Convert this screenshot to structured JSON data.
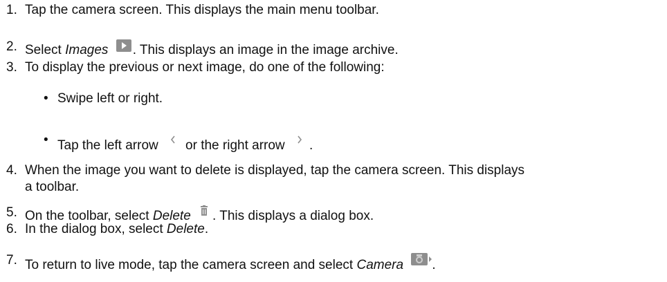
{
  "steps": [
    {
      "num": "1.",
      "text": "Tap the camera screen. This displays the main menu toolbar."
    },
    {
      "num": "2.",
      "pre": "Select ",
      "italic": "Images",
      "post": ". This displays an image in the image archive.",
      "icon": "play-image-icon"
    },
    {
      "num": "3.",
      "text": "To display the previous or next image, do one of the following:"
    },
    {
      "num": "4.",
      "line1": "When the image you want to delete is displayed, tap the camera screen. This displays",
      "line2": "a toolbar."
    },
    {
      "num": "5.",
      "pre": "On the toolbar, select ",
      "italic": "Delete",
      "post": ". This displays a dialog box.",
      "icon": "trash-icon"
    },
    {
      "num": "6.",
      "pre": "In the dialog box, select ",
      "italic": "Delete",
      "post": "."
    },
    {
      "num": "7.",
      "pre": "To return to live mode, tap the camera screen and select ",
      "italic": "Camera",
      "post": ".",
      "icon": "camera-icon"
    }
  ],
  "bullets": [
    {
      "dot": "•",
      "text": "Swipe left or right."
    },
    {
      "dot": "•",
      "pre": "Tap the left arrow",
      "mid": "or the right arrow",
      "post": ".",
      "icons": [
        "left-arrow-icon",
        "right-arrow-icon"
      ]
    }
  ],
  "colors": {
    "text": "#111111",
    "icon_gray": "#8e8e8e"
  }
}
